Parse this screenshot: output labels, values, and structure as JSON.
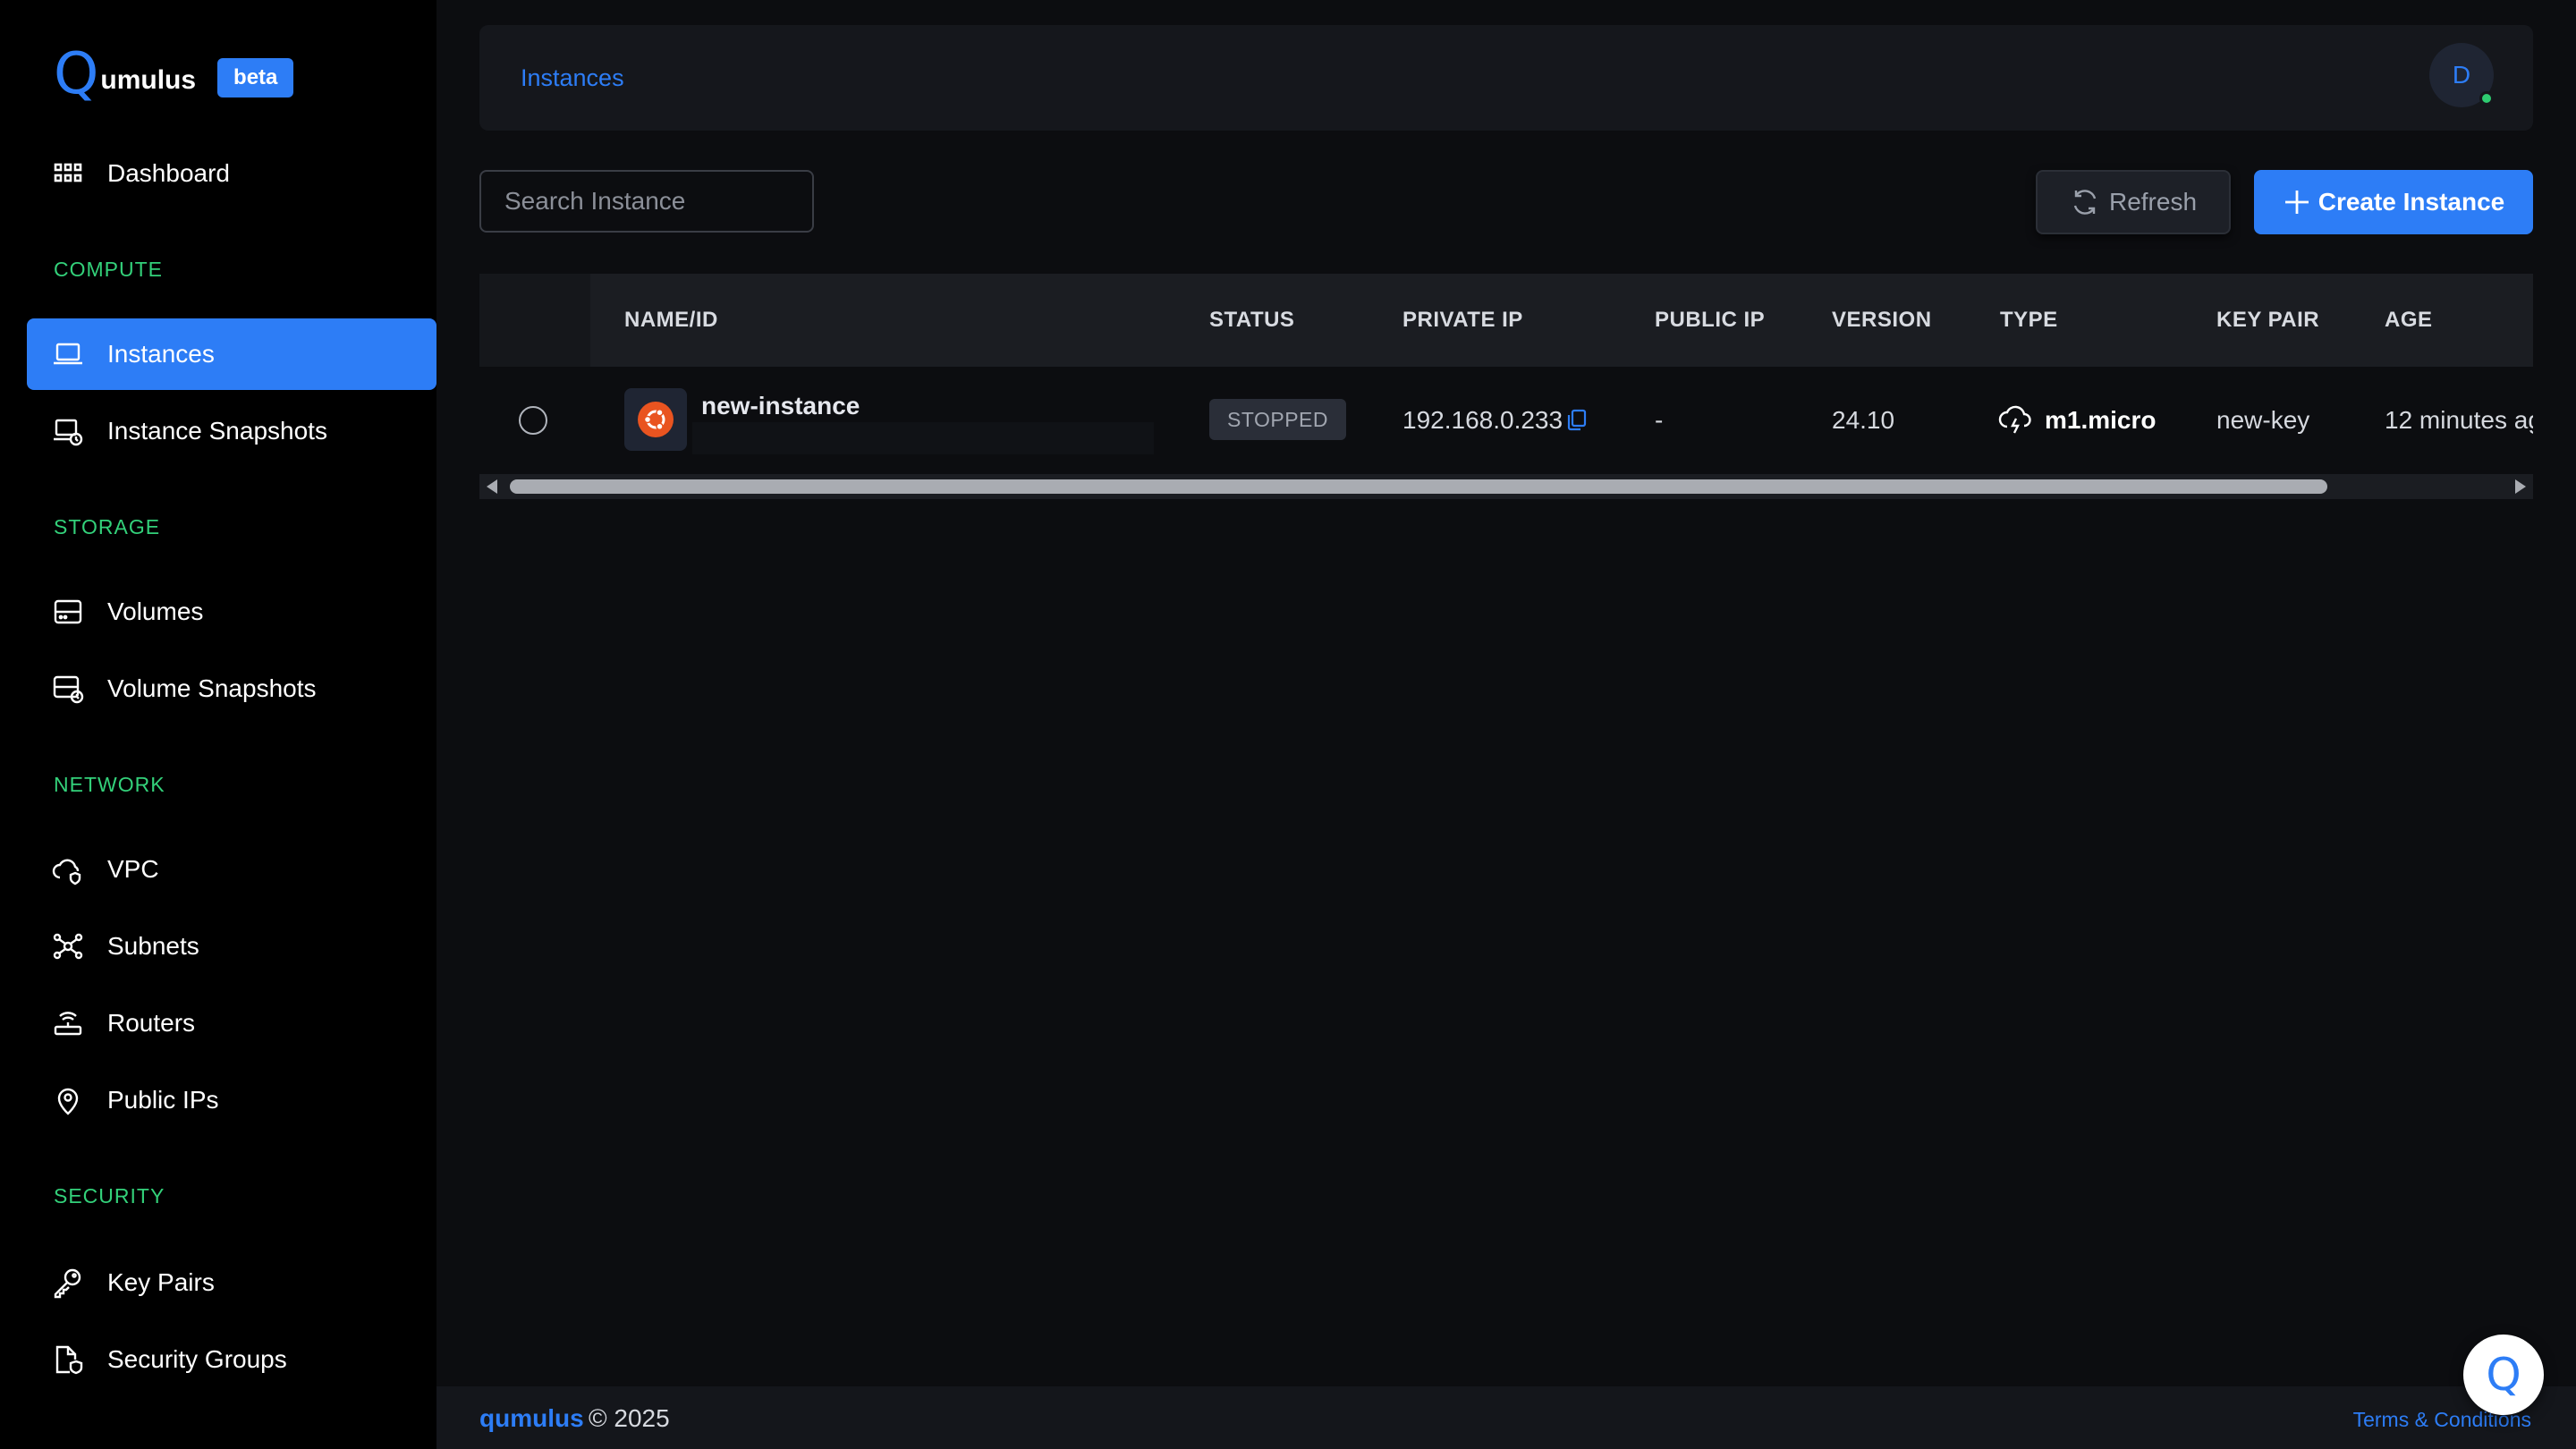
{
  "app": {
    "logo_q": "Q",
    "logo_rest": "umulus",
    "badge": "beta"
  },
  "sidebar": {
    "dashboard": "Dashboard",
    "sections": {
      "compute": "COMPUTE",
      "storage": "STORAGE",
      "network": "NETWORK",
      "security": "SECURITY"
    },
    "items": {
      "instances": "Instances",
      "instance_snapshots": "Instance Snapshots",
      "volumes": "Volumes",
      "volume_snapshots": "Volume Snapshots",
      "vpc": "VPC",
      "subnets": "Subnets",
      "routers": "Routers",
      "public_ips": "Public IPs",
      "key_pairs": "Key Pairs",
      "security_groups": "Security Groups"
    },
    "active": "instances"
  },
  "header": {
    "breadcrumb": "Instances",
    "avatar_initial": "D"
  },
  "toolbar": {
    "search_placeholder": "Search Instance",
    "refresh_label": "Refresh",
    "create_label": "Create Instance"
  },
  "table": {
    "columns": [
      "NAME/ID",
      "STATUS",
      "PRIVATE IP",
      "PUBLIC IP",
      "VERSION",
      "TYPE",
      "KEY PAIR",
      "AGE"
    ],
    "rows": [
      {
        "name": "new-instance",
        "os_icon": "ubuntu-icon",
        "status": "STOPPED",
        "private_ip": "192.168.0.233",
        "public_ip": "-",
        "version": "24.10",
        "type": "m1.micro",
        "key_pair": "new-key",
        "age": "12 minutes ag"
      }
    ]
  },
  "footer": {
    "brand": "qumulus",
    "copyright": "© 2025",
    "terms": "Terms & Conditions"
  },
  "chat": {
    "glyph": "Q"
  },
  "colors": {
    "accent": "#2d7df6",
    "section_label": "#33d17a",
    "online": "#2ecc71",
    "ubuntu": "#e95420"
  }
}
